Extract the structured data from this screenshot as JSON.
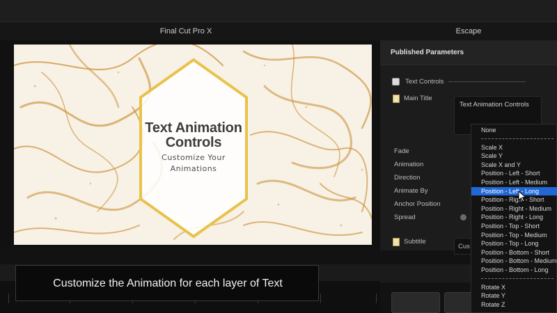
{
  "window": {
    "viewer_title": "Final Cut Pro X",
    "inspector_title": "Escape"
  },
  "canvas": {
    "title_line1": "Text Animation",
    "title_line2": "Controls",
    "subtitle_line1": "Customize Your",
    "subtitle_line2": "Animations",
    "frame_color": "#e8c24a",
    "marble_color": "#c98a2a"
  },
  "inspector": {
    "header": "Published Parameters",
    "text_controls_label": "Text Controls",
    "main_title_label": "Main Title",
    "main_title_value": "Text Animation Controls",
    "params": [
      "Fade",
      "Animation",
      "Direction",
      "Animate By",
      "Anchor Position",
      "Spread"
    ],
    "subtitle_label": "Subtitle",
    "subtitle_value": "Cus"
  },
  "dropdown": {
    "selected": "Position - Left - Long",
    "selected_color": "#2168d6",
    "groups": [
      [
        "None"
      ],
      [
        "Scale X",
        "Scale Y",
        "Scale X and Y",
        "Position - Left - Short",
        "Position - Left - Medium",
        "Position - Left - Long",
        "Position - Right - Short",
        "Position - Right - Medium",
        "Position - Right - Long",
        "Position - Top - Short",
        "Position - Top - Medium",
        "Position - Top - Long",
        "Position - Bottom - Short",
        "Position - Bottom - Medium",
        "Position - Bottom - Long"
      ],
      [
        "Rotate X",
        "Rotate Y",
        "Rotate Z"
      ]
    ]
  },
  "caption": {
    "text": "Customize the Animation for each layer of Text"
  }
}
